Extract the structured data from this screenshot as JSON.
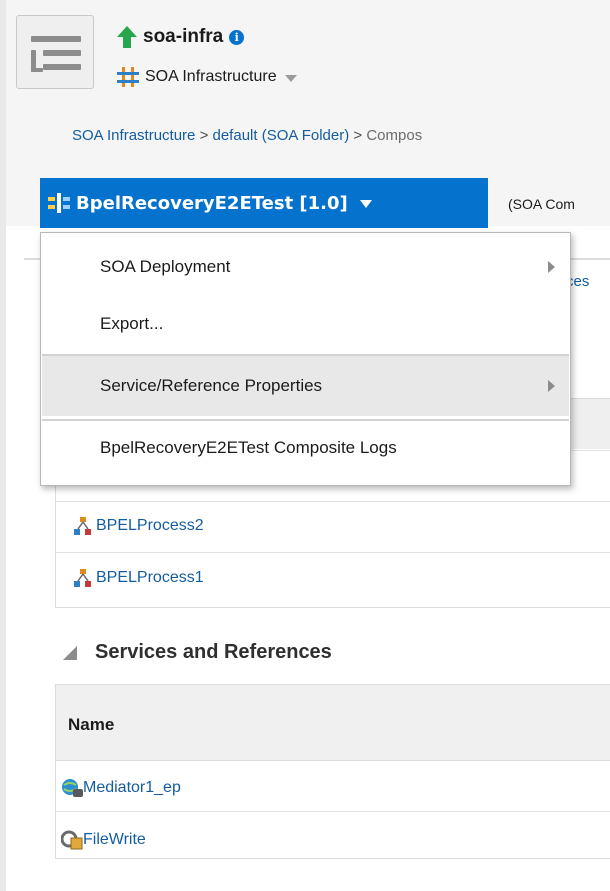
{
  "header": {
    "target_name": "soa-infra",
    "target_type": "SOA Infrastructure"
  },
  "breadcrumb": {
    "items": [
      "SOA Infrastructure",
      "default (SOA Folder)",
      "Compos"
    ],
    "separator": ">"
  },
  "composite": {
    "button_label": "BpelRecoveryE2ETest [1.0]",
    "type_text": "(SOA Com"
  },
  "tabs": {
    "visible_fragment": "ces"
  },
  "context_menu": {
    "items": [
      {
        "label": "SOA Deployment",
        "has_submenu": true
      },
      {
        "label": "Export...",
        "has_submenu": false
      },
      {
        "label": "Service/Reference Properties",
        "has_submenu": true,
        "highlighted": true
      },
      {
        "label": "BpelRecoveryE2ETest Composite Logs",
        "has_submenu": false
      }
    ]
  },
  "components_table": {
    "rows": [
      "BPELProcess2",
      "BPELProcess1"
    ]
  },
  "services_section": {
    "title": "Services and References",
    "column_header": "Name",
    "rows": [
      {
        "name": "Mediator1_ep",
        "icon": "web-service-icon"
      },
      {
        "name": "FileWrite",
        "icon": "file-adapter-icon"
      }
    ]
  },
  "colors": {
    "accent": "#0572ce",
    "link": "#145c9e",
    "up_status": "#27a64d"
  }
}
